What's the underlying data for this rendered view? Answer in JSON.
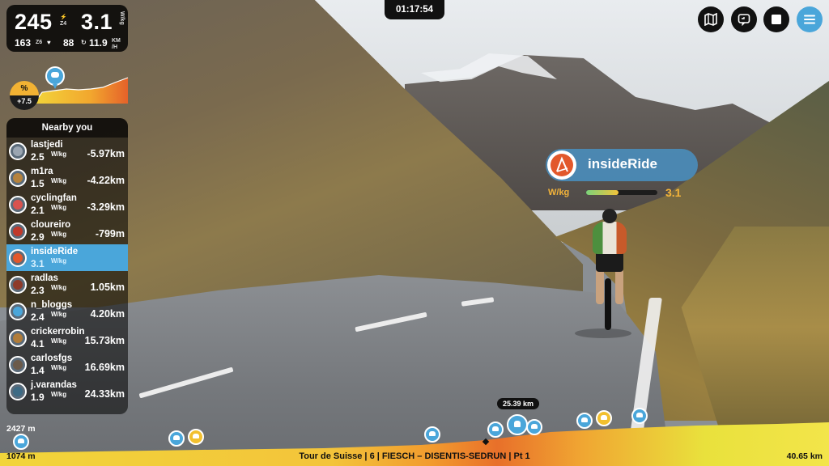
{
  "hud": {
    "power": "245",
    "zone": "Z4",
    "wkg": "3.1",
    "heart_rate": "163",
    "hr_zone": "Z6",
    "cadence": "88",
    "speed": "11.9",
    "speed_unit_top": "KM",
    "speed_unit_bottom": "/H",
    "wkg_unit": "W/kg"
  },
  "grade": {
    "symbol": "%",
    "value": "+7.5"
  },
  "timer": "01:17:54",
  "nearby": {
    "title": "Nearby you",
    "wkg_unit": "W/kg",
    "riders": [
      {
        "name": "lastjedi",
        "wkg": "2.5",
        "distance": "-5.97km",
        "me": false,
        "color": "#9aa5b1"
      },
      {
        "name": "m1ra",
        "wkg": "1.5",
        "distance": "-4.22km",
        "me": false,
        "color": "#b5823d"
      },
      {
        "name": "cyclingfan",
        "wkg": "2.1",
        "distance": "-3.29km",
        "me": false,
        "color": "#d9534f"
      },
      {
        "name": "cloureiro",
        "wkg": "2.9",
        "distance": "-799m",
        "me": false,
        "color": "#c0392b"
      },
      {
        "name": "insideRide",
        "wkg": "3.1",
        "distance": "",
        "me": true,
        "color": "#e2582b"
      },
      {
        "name": "radlas",
        "wkg": "2.3",
        "distance": "1.05km",
        "me": false,
        "color": "#8e3a2a"
      },
      {
        "name": "n_bloggs",
        "wkg": "2.4",
        "distance": "4.20km",
        "me": false,
        "color": "#4aa6da"
      },
      {
        "name": "crickerrobin",
        "wkg": "4.1",
        "distance": "15.73km",
        "me": false,
        "color": "#b07c3a"
      },
      {
        "name": "carlosfgs",
        "wkg": "1.4",
        "distance": "16.69km",
        "me": false,
        "color": "#6b5a4a"
      },
      {
        "name": "j.varandas",
        "wkg": "1.9",
        "distance": "24.33km",
        "me": false,
        "color": "#3d6b85"
      }
    ]
  },
  "controls": [
    "map-icon",
    "camera-icon",
    "stop-icon",
    "menu-icon"
  ],
  "inside_ride": {
    "name": "insideRide",
    "wkg_label": "W/kg",
    "wkg_value": "3.1",
    "wkg_level": 0.45
  },
  "elevation": {
    "altitude_top": "2427 m",
    "altitude_bottom": "1074 m",
    "route": "Tour de Suisse | 6 | FIESCH – DISENTIS-SEDRUN | Pt 1",
    "total_distance": "40.65 km",
    "current_distance": "25.39 km"
  },
  "colors": {
    "accent": "#4aa6da",
    "grade": "#f2b233",
    "wkg_highlight": "#f4b43a"
  }
}
